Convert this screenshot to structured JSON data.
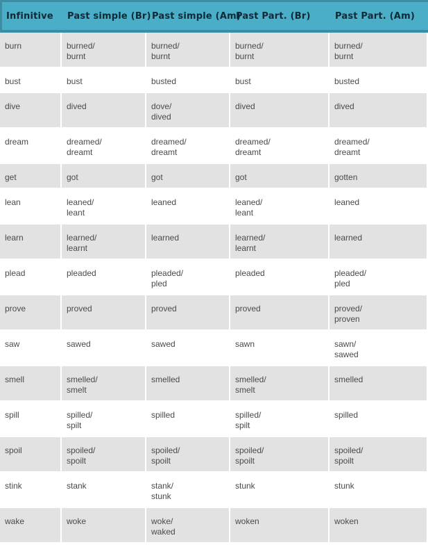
{
  "table": {
    "headers": [
      "Infinitive",
      "Past simple (Br)",
      "Past simple (Am)",
      "Past Part. (Br)",
      "Past Part. (Am)"
    ],
    "colors": {
      "header_bg": "#4aaec8",
      "header_border": "#3b8da4",
      "header_text": "#0d2a36",
      "row_grey": "#e2e2e2",
      "row_white": "#ffffff",
      "cell_text": "#4a4a4a"
    },
    "rows": [
      {
        "bg": "grey",
        "cells": [
          [
            "burn"
          ],
          [
            "burned/",
            "burnt"
          ],
          [
            "burned/",
            "burnt"
          ],
          [
            "burned/",
            "burnt"
          ],
          [
            "burned/",
            "burnt"
          ]
        ]
      },
      {
        "bg": "white",
        "cells": [
          [
            "bust"
          ],
          [
            "bust"
          ],
          [
            "busted"
          ],
          [
            "bust"
          ],
          [
            "busted"
          ]
        ]
      },
      {
        "bg": "grey",
        "cells": [
          [
            "dive"
          ],
          [
            "dived"
          ],
          [
            "dove/",
            "dived"
          ],
          [
            "dived"
          ],
          [
            "dived"
          ]
        ]
      },
      {
        "bg": "white",
        "cells": [
          [
            "dream"
          ],
          [
            "dreamed/",
            "dreamt"
          ],
          [
            "dreamed/",
            "dreamt"
          ],
          [
            "dreamed/",
            "dreamt"
          ],
          [
            "dreamed/",
            "dreamt"
          ]
        ]
      },
      {
        "bg": "grey",
        "cells": [
          [
            "get"
          ],
          [
            "got"
          ],
          [
            "got"
          ],
          [
            "got"
          ],
          [
            "gotten"
          ]
        ]
      },
      {
        "bg": "white",
        "cells": [
          [
            "lean"
          ],
          [
            "leaned/",
            "leant"
          ],
          [
            "leaned"
          ],
          [
            "leaned/",
            "leant"
          ],
          [
            "leaned"
          ]
        ]
      },
      {
        "bg": "grey",
        "cells": [
          [
            "learn"
          ],
          [
            "learned/",
            "learnt"
          ],
          [
            "learned"
          ],
          [
            "learned/",
            "learnt"
          ],
          [
            "learned"
          ]
        ]
      },
      {
        "bg": "white",
        "cells": [
          [
            "plead"
          ],
          [
            "pleaded"
          ],
          [
            "pleaded/",
            "pled"
          ],
          [
            "pleaded"
          ],
          [
            "pleaded/",
            "pled"
          ]
        ]
      },
      {
        "bg": "grey",
        "cells": [
          [
            "prove"
          ],
          [
            "proved"
          ],
          [
            "proved"
          ],
          [
            "proved"
          ],
          [
            "proved/",
            "proven"
          ]
        ]
      },
      {
        "bg": "white",
        "cells": [
          [
            "saw"
          ],
          [
            "sawed"
          ],
          [
            "sawed"
          ],
          [
            "sawn"
          ],
          [
            "sawn/",
            "sawed"
          ]
        ]
      },
      {
        "bg": "grey",
        "cells": [
          [
            "smell"
          ],
          [
            "smelled/",
            "smelt"
          ],
          [
            "smelled"
          ],
          [
            "smelled/",
            "smelt"
          ],
          [
            "smelled"
          ]
        ]
      },
      {
        "bg": "white",
        "cells": [
          [
            "spill"
          ],
          [
            "spilled/",
            "spilt"
          ],
          [
            "spilled"
          ],
          [
            "spilled/",
            "spilt"
          ],
          [
            "spilled"
          ]
        ]
      },
      {
        "bg": "grey",
        "cells": [
          [
            "spoil"
          ],
          [
            "spoiled/",
            "spoilt"
          ],
          [
            "spoiled/",
            "spoilt"
          ],
          [
            "spoiled/",
            "spoilt"
          ],
          [
            "spoiled/",
            "spoilt"
          ]
        ]
      },
      {
        "bg": "white",
        "cells": [
          [
            "stink"
          ],
          [
            "stank"
          ],
          [
            "stank/",
            "stunk"
          ],
          [
            "stunk"
          ],
          [
            "stunk"
          ]
        ]
      },
      {
        "bg": "grey",
        "cells": [
          [
            "wake"
          ],
          [
            "woke"
          ],
          [
            "woke/",
            "waked"
          ],
          [
            "woken"
          ],
          [
            "woken"
          ]
        ]
      }
    ]
  }
}
